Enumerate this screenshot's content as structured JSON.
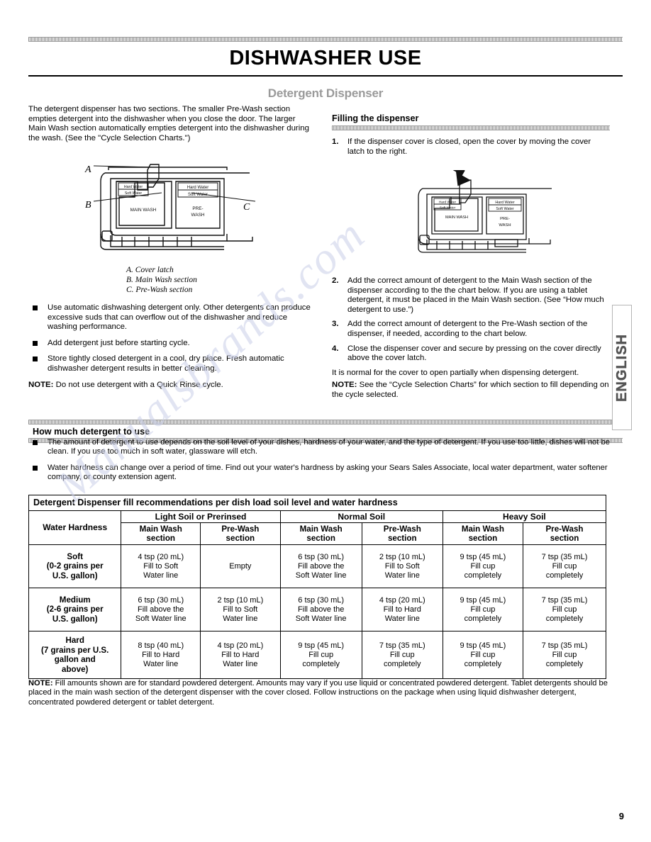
{
  "page": {
    "title": "DISHWASHER USE",
    "subtitle": "Detergent Dispenser",
    "number": "9",
    "side_tab": "ENGLISH",
    "watermark": "Manualsbrands.com"
  },
  "left_column": {
    "intro": "The detergent dispenser has two sections. The smaller Pre-Wash section empties detergent into the dishwasher when you close the door. The larger Main Wash section automatically empties detergent into the dishwasher during the wash. (See the \"Cycle Selection Charts.\")",
    "diagram": {
      "callout_a": "A",
      "callout_b": "B",
      "callout_c": "C",
      "label_main_wash": "MAIN WASH",
      "label_pre_wash_1": "PRE-",
      "label_pre_wash_2": "WASH",
      "label_hard_water": "Hard Water",
      "label_soft_water": "Soft Water",
      "caption_a": "A. Cover latch",
      "caption_b": "B. Main Wash section",
      "caption_c": "C. Pre-Wash section"
    },
    "bullets": [
      "Use automatic dishwashing detergent only. Other detergents can produce excessive suds that can overflow out of the dishwasher and reduce washing performance.",
      "Add detergent just before starting cycle.",
      "Store tightly closed detergent in a cool, dry place. Fresh automatic dishwasher detergent results in better cleaning."
    ],
    "note_label": "NOTE:",
    "note_text": " Do not use detergent with a Quick Rinse cycle."
  },
  "right_column": {
    "section_title": "Filling the dispenser",
    "steps": [
      {
        "num": "1.",
        "text": "If the dispenser cover is closed, open the cover by moving the cover latch to the right."
      },
      {
        "num": "2.",
        "text": "Add the correct amount of detergent to the Main Wash section of the dispenser according to the the chart below. If you are using a tablet detergent, it must be placed in the Main Wash section. (See “How much detergent to use.”)"
      },
      {
        "num": "3.",
        "text": "Add the correct amount of detergent to the Pre-Wash section of the dispenser, if needed, according to the chart below."
      },
      {
        "num": "4.",
        "text": "Close the dispenser cover and secure by pressing on the cover directly above the cover latch."
      }
    ],
    "after_text": "It is normal for the cover to open partially when dispensing detergent.",
    "note_label": "NOTE:",
    "note_text": " See the “Cycle Selection Charts” for which section to fill depending on the cycle selected.",
    "diagram": {
      "label_main_wash": "MAIN WASH",
      "label_pre_wash_1": "PRE-",
      "label_pre_wash_2": "WASH",
      "label_hard_water": "Hard Water",
      "label_soft_water": "Soft Water"
    }
  },
  "how_much": {
    "section_title": "How much detergent to use",
    "bullets": [
      "The amount of detergent to use depends on the soil level of your dishes, hardness of your water, and the type of detergent. If you use too little, dishes will not be clean. If you use too much in soft water, glassware will etch.",
      "Water hardness can change over a period of time. Find out your water's hardness by asking your Sears Sales Associate, local water department, water softener company, or county extension agent."
    ]
  },
  "table": {
    "caption": "Detergent Dispenser fill recommendations per dish load soil level and water hardness",
    "corner_header": "Water Hardness",
    "group_headers": [
      "Light Soil or Prerinsed",
      "Normal Soil",
      "Heavy Soil"
    ],
    "sub_headers": [
      "Main Wash\nsection",
      "Pre-Wash\nsection",
      "Main Wash\nsection",
      "Pre-Wash\nsection",
      "Main Wash\nsection",
      "Pre-Wash\nsection"
    ],
    "sub_header_line1": "Main Wash",
    "sub_header_line1b": "Pre-Wash",
    "sub_header_line2": "section",
    "rows": [
      {
        "label_line1": "Soft",
        "label_line2": "(0-2 grains per",
        "label_line3": "U.S. gallon)",
        "cells": [
          "4 tsp (20 mL)\nFill to Soft\nWater line",
          "Empty",
          "6 tsp (30 mL)\nFill above the\nSoft Water line",
          "2 tsp (10 mL)\nFill to Soft\nWater line",
          "9 tsp (45 mL)\nFill cup\ncompletely",
          "7 tsp (35 mL)\nFill cup\ncompletely"
        ]
      },
      {
        "label_line1": "Medium",
        "label_line2": "(2-6 grains per",
        "label_line3": "U.S. gallon)",
        "cells": [
          "6 tsp (30 mL)\nFill above the\nSoft Water line",
          "2 tsp (10 mL)\nFill to Soft\nWater line",
          "6 tsp (30 mL)\nFill above the\nSoft Water line",
          "4 tsp (20 mL)\nFill to Hard\nWater line",
          "9 tsp (45 mL)\nFill cup\ncompletely",
          "7 tsp (35 mL)\nFill cup\ncompletely"
        ]
      },
      {
        "label_line1": "Hard",
        "label_line2": "(7 grains per U.S.",
        "label_line3": "gallon and",
        "label_line4": "above)",
        "cells": [
          "8 tsp (40 mL)\nFill to Hard\nWater line",
          "4 tsp (20 mL)\nFill to Hard\nWater line",
          "9 tsp (45 mL)\nFill cup\ncompletely",
          "7 tsp (35 mL)\nFill cup\ncompletely",
          "9 tsp (45 mL)\nFill cup\ncompletely",
          "7 tsp (35 mL)\nFill cup\ncompletely"
        ]
      }
    ]
  },
  "bottom_note": {
    "label": "NOTE:",
    "text": " Fill amounts shown are for standard powdered detergent. Amounts may vary if you use liquid or concentrated powdered detergent. Tablet detergents should be placed in the main wash section of the detergent dispenser with the cover closed. Follow instructions on the package when using liquid dishwasher detergent, concentrated powdered detergent or tablet detergent."
  }
}
